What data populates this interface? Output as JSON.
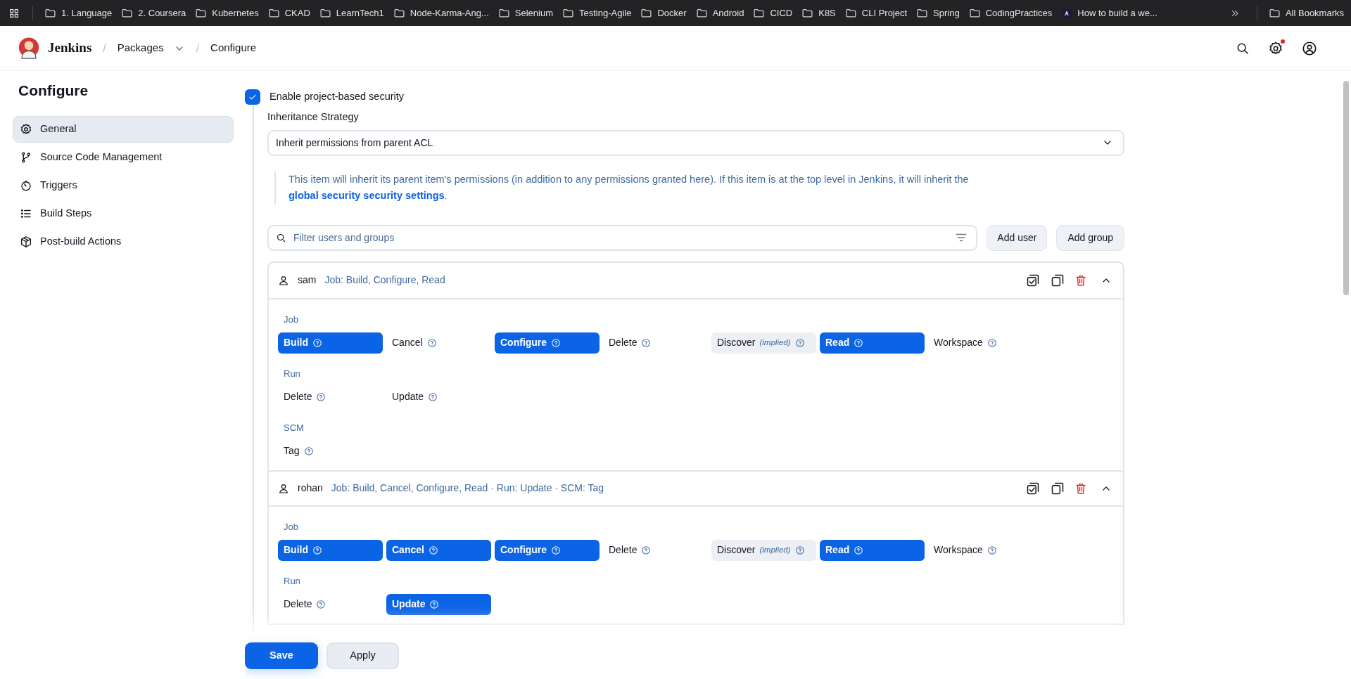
{
  "bookmarks_bar": {
    "items": [
      {
        "label": "1. Language",
        "kind": "folder"
      },
      {
        "label": "2. Coursera",
        "kind": "folder"
      },
      {
        "label": "Kubernetes",
        "kind": "folder"
      },
      {
        "label": "CKAD",
        "kind": "folder"
      },
      {
        "label": "LearnTech1",
        "kind": "folder"
      },
      {
        "label": "Node-Karma-Ang...",
        "kind": "folder"
      },
      {
        "label": "Selenium",
        "kind": "folder"
      },
      {
        "label": "Testing-Agile",
        "kind": "folder"
      },
      {
        "label": "Docker",
        "kind": "folder"
      },
      {
        "label": "Android",
        "kind": "folder"
      },
      {
        "label": "CICD",
        "kind": "folder"
      },
      {
        "label": "K8S",
        "kind": "folder"
      },
      {
        "label": "CLI Project",
        "kind": "folder"
      },
      {
        "label": "Spring",
        "kind": "folder"
      },
      {
        "label": "CodingPractices",
        "kind": "folder"
      },
      {
        "label": "How to build a we...",
        "kind": "site"
      }
    ],
    "all_bookmarks": "All Bookmarks"
  },
  "header": {
    "app_name": "Jenkins",
    "separator": "/",
    "breadcrumbs": [
      {
        "label": "Packages",
        "has_menu": true
      },
      {
        "label": "Configure",
        "has_menu": false
      }
    ],
    "settings_notification": true
  },
  "sidebar": {
    "title": "Configure",
    "items": [
      {
        "label": "General",
        "kind": "gear",
        "selected": true
      },
      {
        "label": "Source Code Management",
        "kind": "branch",
        "selected": false
      },
      {
        "label": "Triggers",
        "kind": "timer",
        "selected": false
      },
      {
        "label": "Build Steps",
        "kind": "list",
        "selected": false
      },
      {
        "label": "Post-build Actions",
        "kind": "package",
        "selected": false
      }
    ]
  },
  "security": {
    "enable_label": "Enable project-based security",
    "checked": true,
    "inheritance_label": "Inheritance Strategy",
    "inheritance_value": "Inherit permissions from parent ACL",
    "note": "This item will inherit its parent item's permissions (in addition to any permissions granted here). If this item is at the top level in Jenkins, it will inherit the",
    "note_link": "global security security settings",
    "note_end": ".",
    "filter_placeholder": "Filter users and groups",
    "add_user": "Add user",
    "add_group": "Add group",
    "users": [
      {
        "name": "sam",
        "summary": "Job: Build, Configure, Read",
        "expanded": true,
        "groups": [
          {
            "label": "Job",
            "permissions": [
              {
                "label": "Build",
                "granted": true
              },
              {
                "label": "Cancel",
                "granted": false
              },
              {
                "label": "Configure",
                "granted": true
              },
              {
                "label": "Delete",
                "granted": false
              },
              {
                "label": "Discover",
                "granted": false,
                "implied": "(implied)"
              },
              {
                "label": "Read",
                "granted": true
              },
              {
                "label": "Workspace",
                "granted": false
              }
            ]
          },
          {
            "label": "Run",
            "permissions": [
              {
                "label": "Delete",
                "granted": false
              },
              {
                "label": "Update",
                "granted": false
              }
            ]
          },
          {
            "label": "SCM",
            "permissions": [
              {
                "label": "Tag",
                "granted": false
              }
            ]
          }
        ]
      },
      {
        "name": "rohan",
        "summary": "Job: Build, Cancel, Configure, Read · Run: Update · SCM: Tag",
        "expanded": true,
        "groups": [
          {
            "label": "Job",
            "permissions": [
              {
                "label": "Build",
                "granted": true
              },
              {
                "label": "Cancel",
                "granted": true
              },
              {
                "label": "Configure",
                "granted": true
              },
              {
                "label": "Delete",
                "granted": false
              },
              {
                "label": "Discover",
                "granted": false,
                "implied": "(implied)"
              },
              {
                "label": "Read",
                "granted": true
              },
              {
                "label": "Workspace",
                "granted": false
              }
            ]
          },
          {
            "label": "Run",
            "permissions": [
              {
                "label": "Delete",
                "granted": false
              },
              {
                "label": "Update",
                "granted": true
              }
            ]
          }
        ]
      }
    ]
  },
  "actions": {
    "save": "Save",
    "apply": "Apply"
  }
}
